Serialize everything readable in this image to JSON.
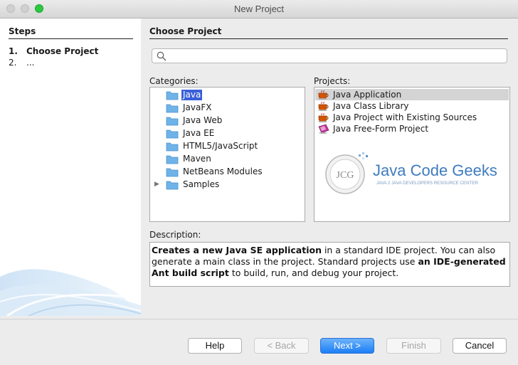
{
  "window": {
    "title": "New Project"
  },
  "steps": {
    "title": "Steps",
    "items": [
      {
        "num": "1.",
        "label": "Choose Project"
      },
      {
        "num": "2.",
        "label": "..."
      }
    ]
  },
  "main": {
    "title": "Choose Project",
    "search": {
      "placeholder": "",
      "value": ""
    },
    "categories_label": "Categories:",
    "projects_label": "Projects:",
    "description_label": "Description:"
  },
  "categories": [
    {
      "label": "Java",
      "selected": true,
      "expandable": false
    },
    {
      "label": "JavaFX",
      "selected": false,
      "expandable": false
    },
    {
      "label": "Java Web",
      "selected": false,
      "expandable": false
    },
    {
      "label": "Java EE",
      "selected": false,
      "expandable": false
    },
    {
      "label": "HTML5/JavaScript",
      "selected": false,
      "expandable": false
    },
    {
      "label": "Maven",
      "selected": false,
      "expandable": false
    },
    {
      "label": "NetBeans Modules",
      "selected": false,
      "expandable": false
    },
    {
      "label": "Samples",
      "selected": false,
      "expandable": true
    }
  ],
  "projects": [
    {
      "label": "Java Application",
      "icon": "coffee-cup-icon",
      "selected": true
    },
    {
      "label": "Java Class Library",
      "icon": "coffee-cup-icon",
      "selected": false
    },
    {
      "label": "Java Project with Existing Sources",
      "icon": "coffee-cup-icon",
      "selected": false
    },
    {
      "label": "Java Free-Form Project",
      "icon": "coffee-cup-free-form-icon",
      "selected": false
    }
  ],
  "watermark": {
    "logo": "JCG",
    "brand": "Java Code Geeks",
    "tagline": "JAVA 2 JAVA DEVELOPERS RESOURCE CENTER"
  },
  "description": {
    "p1_bold": "Creates a new Java SE application",
    "p1_rest": " in a standard IDE project. You can also generate a main class in the project. Standard projects use ",
    "p2_bold": "an IDE-generated Ant build script",
    "p2_rest": " to build, run, and debug your project."
  },
  "buttons": {
    "help": "Help",
    "back": "< Back",
    "next": "Next >",
    "finish": "Finish",
    "cancel": "Cancel"
  },
  "colors": {
    "selection": "#3a5fd8",
    "primary_button": "#1c7ef6",
    "folder": "#6fb3e8"
  }
}
